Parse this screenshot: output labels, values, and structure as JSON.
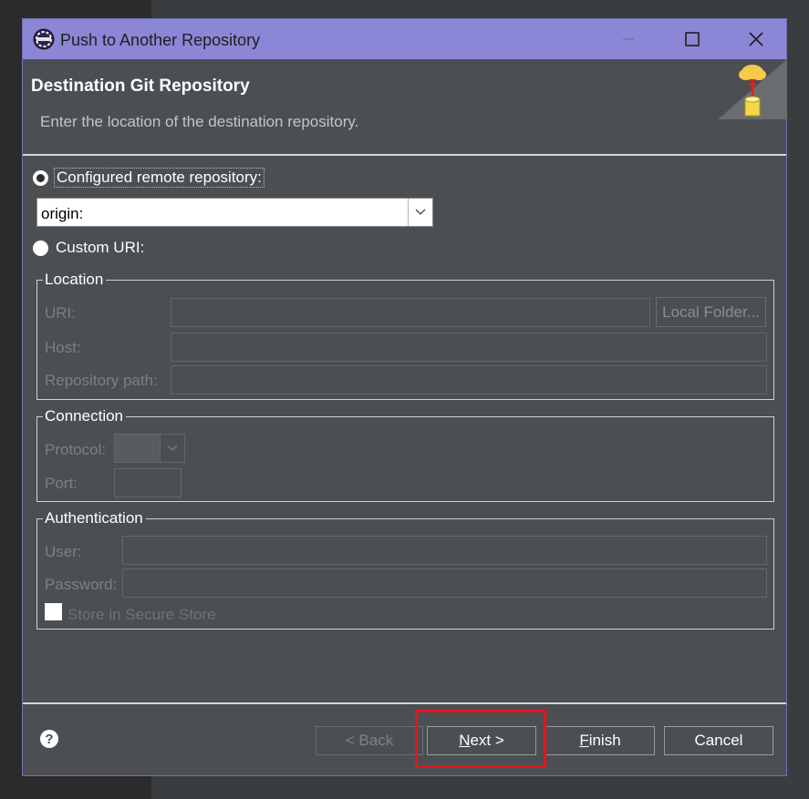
{
  "window": {
    "title": "Push to Another Repository",
    "controls": [
      "minimize-icon",
      "maximize-icon",
      "close-icon"
    ]
  },
  "header": {
    "title": "Destination Git Repository",
    "description": "Enter the location of the destination repository."
  },
  "source": {
    "configured_remote_label": "Configured remote repository:",
    "configured_remote_selected": true,
    "remote_value": "origin:",
    "custom_uri_label": "Custom URI:",
    "custom_uri_selected": false
  },
  "location": {
    "legend": "Location",
    "uri_label": "URI:",
    "uri_value": "",
    "local_folder_button": "Local Folder...",
    "host_label": "Host:",
    "host_value": "",
    "repo_path_label": "Repository path:",
    "repo_path_value": ""
  },
  "connection": {
    "legend": "Connection",
    "protocol_label": "Protocol:",
    "protocol_value": "",
    "port_label": "Port:",
    "port_value": ""
  },
  "authentication": {
    "legend": "Authentication",
    "user_label": "User:",
    "user_value": "",
    "password_label": "Password:",
    "password_value": "",
    "store_label": "Store in Secure Store",
    "store_checked": false
  },
  "footer": {
    "help_symbol": "?",
    "back_label": "< Back",
    "next_pre": "",
    "next_mnemonic": "N",
    "next_post": "ext >",
    "finish_mnemonic": "F",
    "finish_post": "inish",
    "cancel_label": "Cancel"
  },
  "colors": {
    "titlebar": "#8b87d6",
    "dialog_bg": "#4b4f52",
    "highlight": "#e8121f"
  }
}
